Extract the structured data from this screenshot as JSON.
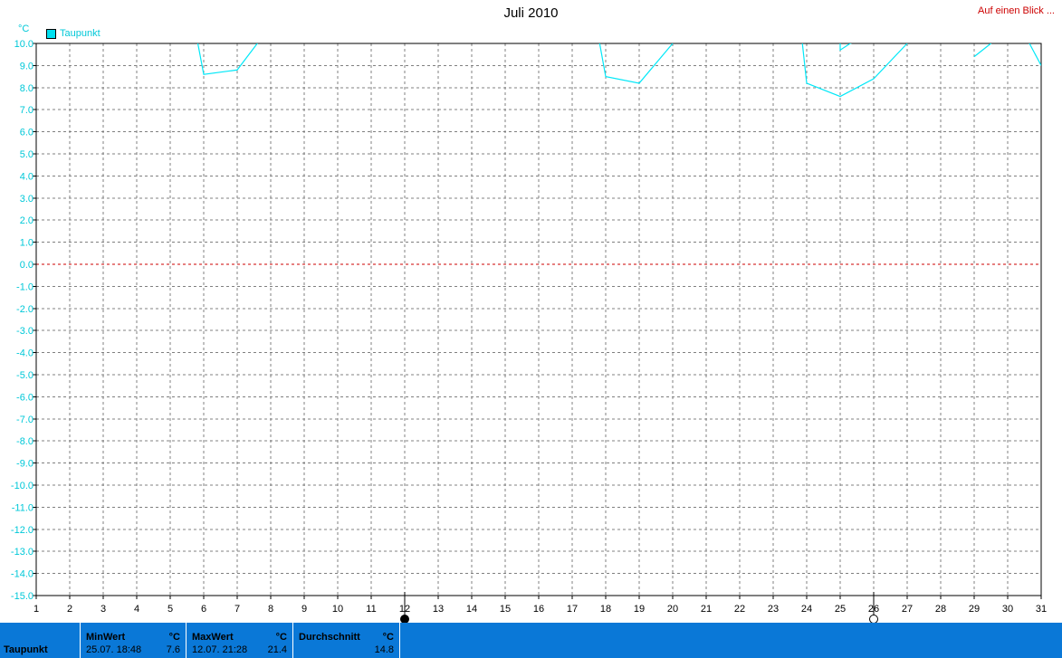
{
  "header": {
    "title": "Juli 2010",
    "overview_link": "Auf einen Blick ..."
  },
  "colors": {
    "series": "#00e8f8",
    "zero_line": "#cc0000",
    "grid": "#808080",
    "axis_text_y": "#00c8d8",
    "stats_bg": "#0a78d7"
  },
  "chart_data": {
    "type": "line",
    "title": "Juli 2010",
    "unit": "°C",
    "xlim": [
      1,
      31
    ],
    "ylim": [
      -15,
      10
    ],
    "x_ticks": [
      "1",
      "2",
      "3",
      "4",
      "5",
      "6",
      "7",
      "8",
      "9",
      "10",
      "11",
      "12",
      "13",
      "14",
      "15",
      "16",
      "17",
      "18",
      "19",
      "20",
      "21",
      "22",
      "23",
      "24",
      "25",
      "26",
      "27",
      "28",
      "29",
      "30",
      "31"
    ],
    "y_ticks": [
      "10.0",
      "9.0",
      "8.0",
      "7.0",
      "6.0",
      "5.0",
      "4.0",
      "3.0",
      "2.0",
      "1.0",
      "0.0",
      "-1.0",
      "-2.0",
      "-3.0",
      "-4.0",
      "-5.0",
      "-6.0",
      "-7.0",
      "-8.0",
      "-9.0",
      "-10.0",
      "-11.0",
      "-12.0",
      "-13.0",
      "-14.0",
      "-15.0"
    ],
    "grid": true,
    "legend": "top-left",
    "series": [
      {
        "name": "Taupunkt",
        "points": [
          [
            5.7,
            11.0
          ],
          [
            6.0,
            8.6
          ],
          [
            7.0,
            8.8
          ],
          [
            7.7,
            10.2
          ],
          [
            8.0,
            11.0
          ],
          [
            17.7,
            11.0
          ],
          [
            18.0,
            8.5
          ],
          [
            19.0,
            8.2
          ],
          [
            20.0,
            10.0
          ],
          [
            20.2,
            11.0
          ],
          [
            23.8,
            11.0
          ],
          [
            24.0,
            8.2
          ],
          [
            25.0,
            7.6
          ],
          [
            26.0,
            8.4
          ],
          [
            27.0,
            10.0
          ],
          [
            27.2,
            11.0
          ],
          [
            25.0,
            10.0
          ],
          [
            25.0,
            9.7
          ],
          [
            25.3,
            10.0
          ],
          [
            25.5,
            10.1
          ],
          [
            28.7,
            11.0
          ],
          [
            29.0,
            9.4
          ],
          [
            29.5,
            10.0
          ],
          [
            29.7,
            11.0
          ],
          [
            30.3,
            11.0
          ],
          [
            31.0,
            9.0
          ]
        ]
      }
    ],
    "markers": [
      {
        "x": 12,
        "type": "max",
        "filled": true
      },
      {
        "x": 26,
        "type": "min",
        "filled": false
      }
    ]
  },
  "stats": {
    "series_label": "Taupunkt",
    "min": {
      "header": "MinWert",
      "unit": "°C",
      "date": "25.07.  18:48",
      "value": "7.6"
    },
    "max": {
      "header": "MaxWert",
      "unit": "°C",
      "date": "12.07.  21:28",
      "value": "21.4"
    },
    "avg": {
      "header": "Durchschnitt",
      "unit": "°C",
      "value": "14.8"
    }
  }
}
